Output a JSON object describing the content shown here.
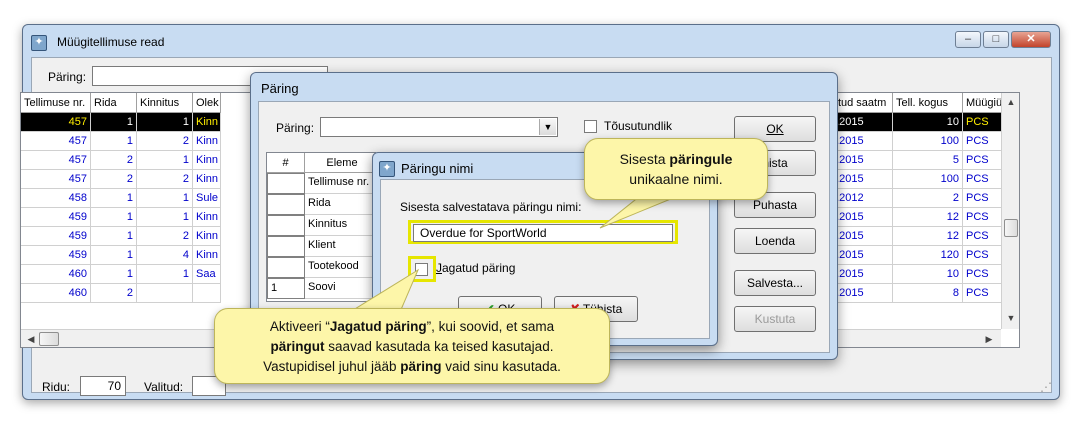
{
  "main": {
    "title": "Müügitellimuse read",
    "query_label": "Päring:",
    "window_buttons": [
      "–",
      "□",
      "✕"
    ],
    "grid": {
      "headers": [
        "Tellimuse nr.",
        "Rida",
        "Kinnitus",
        "Olek",
        "vitud saatm",
        "Tell. kogus",
        "Müügiühik"
      ],
      "rows": [
        {
          "nr": "457",
          "rida": "1",
          "kinnitus": "1",
          "olek": "Kinn",
          "date": "7.2015",
          "kogus": "10",
          "yhik": "PCS"
        },
        {
          "nr": "457",
          "rida": "1",
          "kinnitus": "2",
          "olek": "Kinn",
          "date": "7.2015",
          "kogus": "100",
          "yhik": "PCS"
        },
        {
          "nr": "457",
          "rida": "2",
          "kinnitus": "1",
          "olek": "Kinn",
          "date": "7.2015",
          "kogus": "5",
          "yhik": "PCS"
        },
        {
          "nr": "457",
          "rida": "2",
          "kinnitus": "2",
          "olek": "Kinn",
          "date": "7.2015",
          "kogus": "100",
          "yhik": "PCS"
        },
        {
          "nr": "458",
          "rida": "1",
          "kinnitus": "1",
          "olek": "Sule",
          "date": "5.2012",
          "kogus": "2",
          "yhik": "PCS"
        },
        {
          "nr": "459",
          "rida": "1",
          "kinnitus": "1",
          "olek": "Kinn",
          "date": "7.2015",
          "kogus": "12",
          "yhik": "PCS"
        },
        {
          "nr": "459",
          "rida": "1",
          "kinnitus": "2",
          "olek": "Kinn",
          "date": "7.2015",
          "kogus": "12",
          "yhik": "PCS"
        },
        {
          "nr": "459",
          "rida": "1",
          "kinnitus": "4",
          "olek": "Kinn",
          "date": "7.2015",
          "kogus": "120",
          "yhik": "PCS"
        },
        {
          "nr": "460",
          "rida": "1",
          "kinnitus": "1",
          "olek": "Saa",
          "date": "3.2015",
          "kogus": "10",
          "yhik": "PCS"
        },
        {
          "nr": "460",
          "rida": "2",
          "kinnitus": "",
          "olek": "",
          "date": "5.2015",
          "kogus": "8",
          "yhik": "PCS"
        }
      ]
    },
    "status": {
      "ridu_label": "Ridu:",
      "ridu_value": "70",
      "valitud_label": "Valitud:"
    }
  },
  "dlg_query": {
    "title": "Päring",
    "query_label": "Päring:",
    "rising_label": "Tõusutundlik",
    "col_hash": "#",
    "col_element": "Eleme",
    "elements": [
      "Tellimuse nr.",
      "Rida",
      "Kinnitus",
      "Klient",
      "Tootekood",
      "Soovi"
    ],
    "row_number": "1",
    "buttons": {
      "ok": "OK",
      "cancel": "hista",
      "clear": "Puhasta",
      "list": "Loenda",
      "save": "Salvesta...",
      "delete": "Kustuta"
    }
  },
  "dlg_name": {
    "title": "Päringu nimi",
    "prompt": "Sisesta salvestatava päringu nimi:",
    "value": "Overdue for SportWorld",
    "shared_label": "Jagatud päring",
    "ok": "OK",
    "cancel": "Tühista"
  },
  "callout_top": {
    "part1": "Sisesta ",
    "bold": "päringule",
    "part2": "unikaalne nimi."
  },
  "callout_bottom": {
    "l1a": "Aktiveeri “",
    "l1b": "Jagatud päring",
    "l1c": "”, kui soovid, et sama",
    "l2a": "päringut",
    "l2b": " saavad kasutada ka teised kasutajad.",
    "l3a": "Vastupidisel juhul jääb ",
    "l3b": "päring",
    "l3c": " vaid sinu kasutada."
  },
  "colors": {
    "accent_yellow": "#e6e600",
    "callout_bg": "#fdf6a9",
    "row_text": "#0000cc"
  }
}
